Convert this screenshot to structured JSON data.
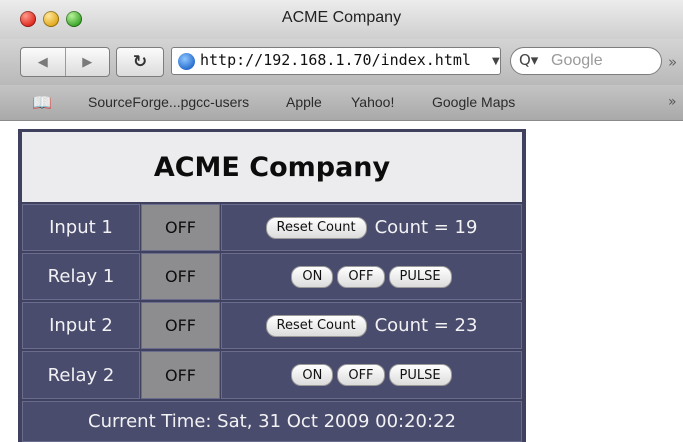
{
  "browser": {
    "window_title": "ACME Company",
    "url": "http://192.168.1.70/index.html",
    "search_placeholder": "Google",
    "bookmarks": [
      "SourceForge...pgcc-users",
      "Apple",
      "Yahoo!",
      "Google Maps"
    ]
  },
  "page": {
    "title": "ACME Company",
    "rows": [
      {
        "label": "Input 1",
        "state": "OFF",
        "type": "input",
        "reset_label": "Reset Count",
        "count_text": "Count = 19"
      },
      {
        "label": "Relay 1",
        "state": "OFF",
        "type": "relay",
        "buttons": [
          "ON",
          "OFF",
          "PULSE"
        ]
      },
      {
        "label": "Input 2",
        "state": "OFF",
        "type": "input",
        "reset_label": "Reset Count",
        "count_text": "Count = 23"
      },
      {
        "label": "Relay 2",
        "state": "OFF",
        "type": "relay",
        "buttons": [
          "ON",
          "OFF",
          "PULSE"
        ]
      }
    ],
    "footer": "Current Time: Sat, 31 Oct 2009 00:20:22"
  },
  "colors": {
    "panel_border": "#40415f",
    "cell_bg": "#4a4c6d",
    "state_bg": "#8d8d8f",
    "header_bg": "#ececef"
  }
}
